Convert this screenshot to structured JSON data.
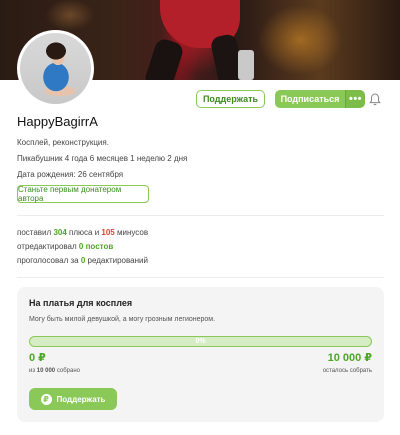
{
  "profile": {
    "username": "HappyBagirrA",
    "description": "Косплей, реконструкция.",
    "tenure": "Пикабушник 4 года 6 месяцев 1 неделю 2 дня",
    "birthday": "Дата рождения: 26 сентября",
    "donate_first_label": "Станьте первым донатером автора"
  },
  "actions": {
    "support_label": "Поддержать",
    "subscribe_label": "Подписаться",
    "more_label": "•••"
  },
  "stats": {
    "line1_prefix": "поставил",
    "pluses": "304",
    "line1_mid": "плюса и",
    "minuses": "105",
    "line1_suffix": "минусов",
    "line2_prefix": "отредактировал",
    "edited_posts": "0 постов",
    "line3_prefix": "проголосовал за",
    "voted_edits": "0",
    "line3_suffix": "редактирований"
  },
  "fundraiser": {
    "title": "На платья для косплея",
    "description": "Могу быть милой девушкой, а могу грозным легионером.",
    "progress_label": "0%",
    "progress_fraction": 0,
    "collected": "0 ₽",
    "collected_sub_prefix": "из",
    "collected_sub_amount": "10 000",
    "collected_sub_suffix": "собрано",
    "goal": "10 000 ₽",
    "goal_sub": "осталось собрать",
    "donate_label": "Поддержать",
    "ruble_symbol": "₽"
  },
  "colors": {
    "accent_green": "#8ac858",
    "text_green": "#4ea628",
    "text_red": "#d84432"
  },
  "icons": {
    "bell": "bell-icon",
    "ruble": "ruble-icon"
  }
}
